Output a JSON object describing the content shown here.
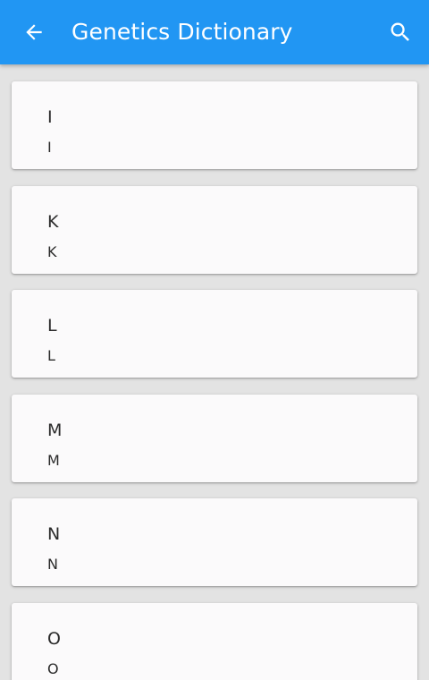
{
  "appbar": {
    "title": "Genetics Dictionary",
    "back_icon": "arrow-back-icon",
    "search_icon": "search-icon",
    "color": "#2196f3"
  },
  "entries": [
    {
      "term": "I",
      "subtitle": "I"
    },
    {
      "term": "K",
      "subtitle": "K"
    },
    {
      "term": "L",
      "subtitle": "L"
    },
    {
      "term": "M",
      "subtitle": "M"
    },
    {
      "term": "N",
      "subtitle": "N"
    },
    {
      "term": "O",
      "subtitle": "O"
    }
  ]
}
